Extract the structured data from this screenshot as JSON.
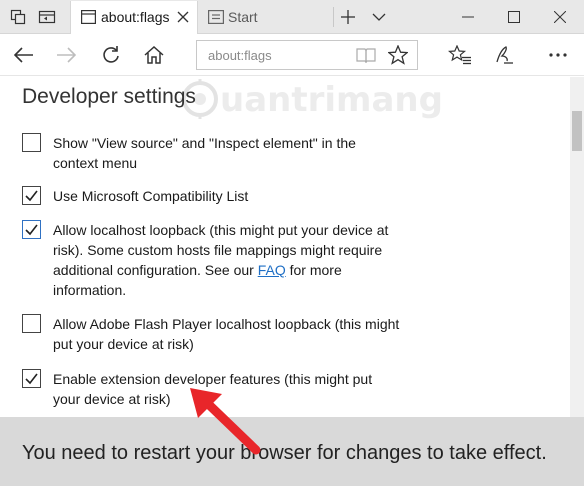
{
  "tabs": [
    {
      "label": "about:flags",
      "active": true
    },
    {
      "label": "Start",
      "active": false
    }
  ],
  "address_bar": {
    "value": "about:flags"
  },
  "page": {
    "heading": "Developer settings",
    "watermark": "uantrimang",
    "options": [
      {
        "line1": "Show \"View source\" and \"Inspect element\" in the",
        "line2": "context menu",
        "checked": false
      },
      {
        "line1": "Use Microsoft Compatibility List",
        "checked": true
      },
      {
        "line1": "Allow localhost loopback (this might put your device at",
        "line2": "risk). Some custom hosts file mappings might require",
        "line3_pre": "additional configuration. See our ",
        "link": "FAQ",
        "line3_post": " for more",
        "line4": "information.",
        "checked": true
      },
      {
        "line1": "Allow Adobe Flash Player localhost loopback (this might",
        "line2": "put your device at risk)",
        "checked": false
      },
      {
        "line1": "Enable extension developer features (this might put",
        "line2": "your device at risk)",
        "checked": true
      }
    ],
    "restart_notice": "You need to restart your browser for changes to take effect."
  },
  "colors": {
    "accent": "#2f71c3",
    "link": "#1f6fc5",
    "arrow": "#e8262a",
    "notice_bg": "#d9d9d9"
  },
  "icons": [
    "tab-preview-icon",
    "set-aside-icon",
    "page-icon",
    "tab-close-icon",
    "start-page-icon",
    "new-tab-icon",
    "tab-list-icon",
    "minimize-icon",
    "maximize-icon",
    "window-close-icon",
    "back-icon",
    "forward-icon",
    "refresh-icon",
    "home-icon",
    "reading-view-icon",
    "favorite-star-icon",
    "hub-icon",
    "web-note-icon",
    "more-icon"
  ]
}
